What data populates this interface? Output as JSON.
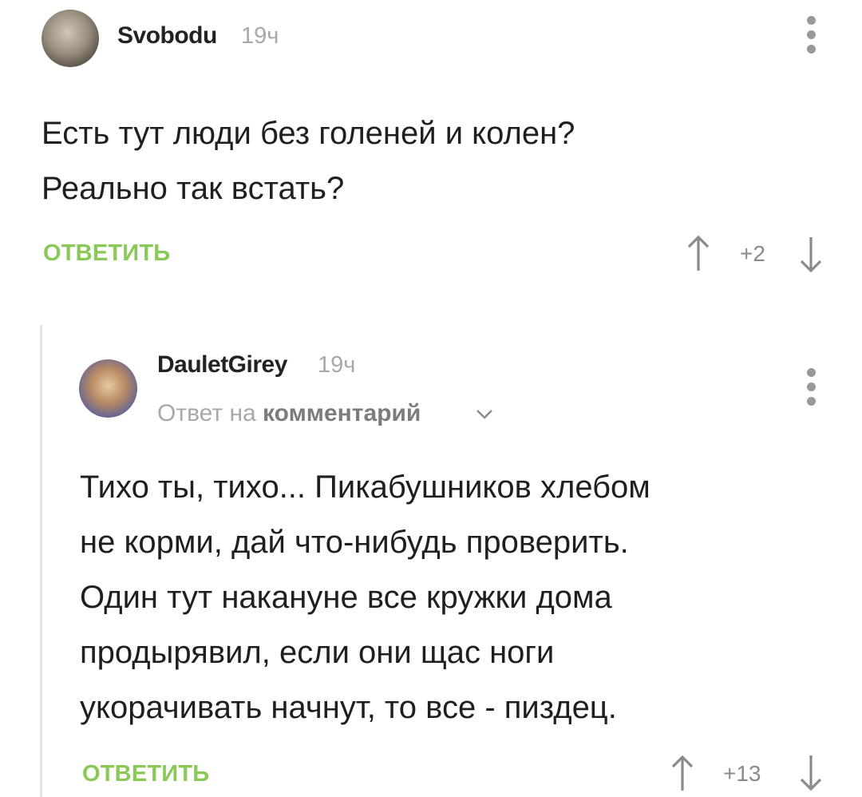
{
  "comments": [
    {
      "username": "Svobodu",
      "time": "19ч",
      "text": "Есть тут люди без голеней и колен?\nРеально так встать?",
      "reply_label": "ОТВЕТИТЬ",
      "score": "+2"
    },
    {
      "username": "DauletGirey",
      "time": "19ч",
      "reply_prefix": "Ответ на",
      "reply_link": "комментарий",
      "text": "Тихо ты, тихо... Пикабушников хлебом\nне корми, дай что-нибудь проверить.\nОдин тут накануне все кружки дома\nпродырявил, если они щас ноги\nукорачивать начнут, то все - пиздец.",
      "reply_label": "ОТВЕТИТЬ",
      "score": "+13"
    }
  ],
  "colors": {
    "accent_green": "#8ac858",
    "muted_gray": "#a8a8a8",
    "text_dark": "#1f1f1f",
    "thread_line": "#e2e2e2"
  }
}
